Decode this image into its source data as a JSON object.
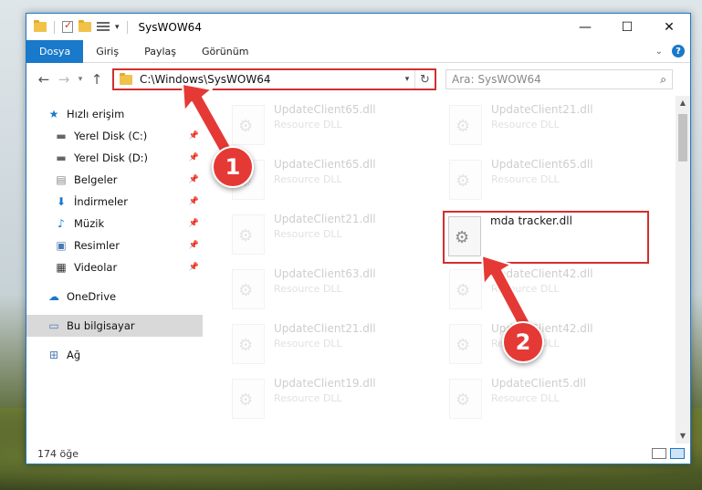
{
  "titlebar": {
    "title": "SysWOW64",
    "minimize": "—",
    "maximize": "☐",
    "close": "✕"
  },
  "ribbon": {
    "tabs": [
      "Dosya",
      "Giriş",
      "Paylaş",
      "Görünüm"
    ],
    "help": "?"
  },
  "nav": {
    "back": "←",
    "forward": "→",
    "recent": "▾",
    "up": "↑",
    "address": "C:\\Windows\\SysWOW64",
    "refresh": "↻",
    "search_placeholder": "Ara: SysWOW64",
    "search_icon": "⌕"
  },
  "sidebar": {
    "quick_access": "Hızlı erişim",
    "items": [
      {
        "label": "Yerel Disk (C:)",
        "icon": "drive-icon"
      },
      {
        "label": "Yerel Disk (D:)",
        "icon": "drive-icon"
      },
      {
        "label": "Belgeler",
        "icon": "documents-icon"
      },
      {
        "label": "İndirmeler",
        "icon": "download-icon"
      },
      {
        "label": "Müzik",
        "icon": "music-icon"
      },
      {
        "label": "Resimler",
        "icon": "pictures-icon"
      },
      {
        "label": "Videolar",
        "icon": "videos-icon"
      }
    ],
    "onedrive": "OneDrive",
    "this_pc": "Bu bilgisayar",
    "network": "Ağ"
  },
  "files": [
    {
      "name": "UpdateClient65.dll",
      "type": "Resource DLL"
    },
    {
      "name": "UpdateClient21.dll",
      "type": "Resource DLL"
    },
    {
      "name": "UpdateClient65.dll",
      "type": "Resource DLL"
    },
    {
      "name": "UpdateClient65.dll",
      "type": "Resource DLL"
    },
    {
      "name": "UpdateClient21.dll",
      "type": "Resource DLL"
    },
    {
      "name": "mda tracker.dll",
      "type": ""
    },
    {
      "name": "UpdateClient63.dll",
      "type": "Resource DLL"
    },
    {
      "name": "UpdateClient42.dll",
      "type": "Resource DLL"
    },
    {
      "name": "UpdateClient21.dll",
      "type": "Resource DLL"
    },
    {
      "name": "UpdateClient42.dll",
      "type": "Resource DLL"
    },
    {
      "name": "UpdateClient19.dll",
      "type": "Resource DLL"
    },
    {
      "name": "UpdateClient5.dll",
      "type": "Resource DLL"
    }
  ],
  "status": {
    "item_count": "174 öğe"
  },
  "annotations": {
    "marker1": "1",
    "marker2": "2",
    "color": "#e53935"
  }
}
